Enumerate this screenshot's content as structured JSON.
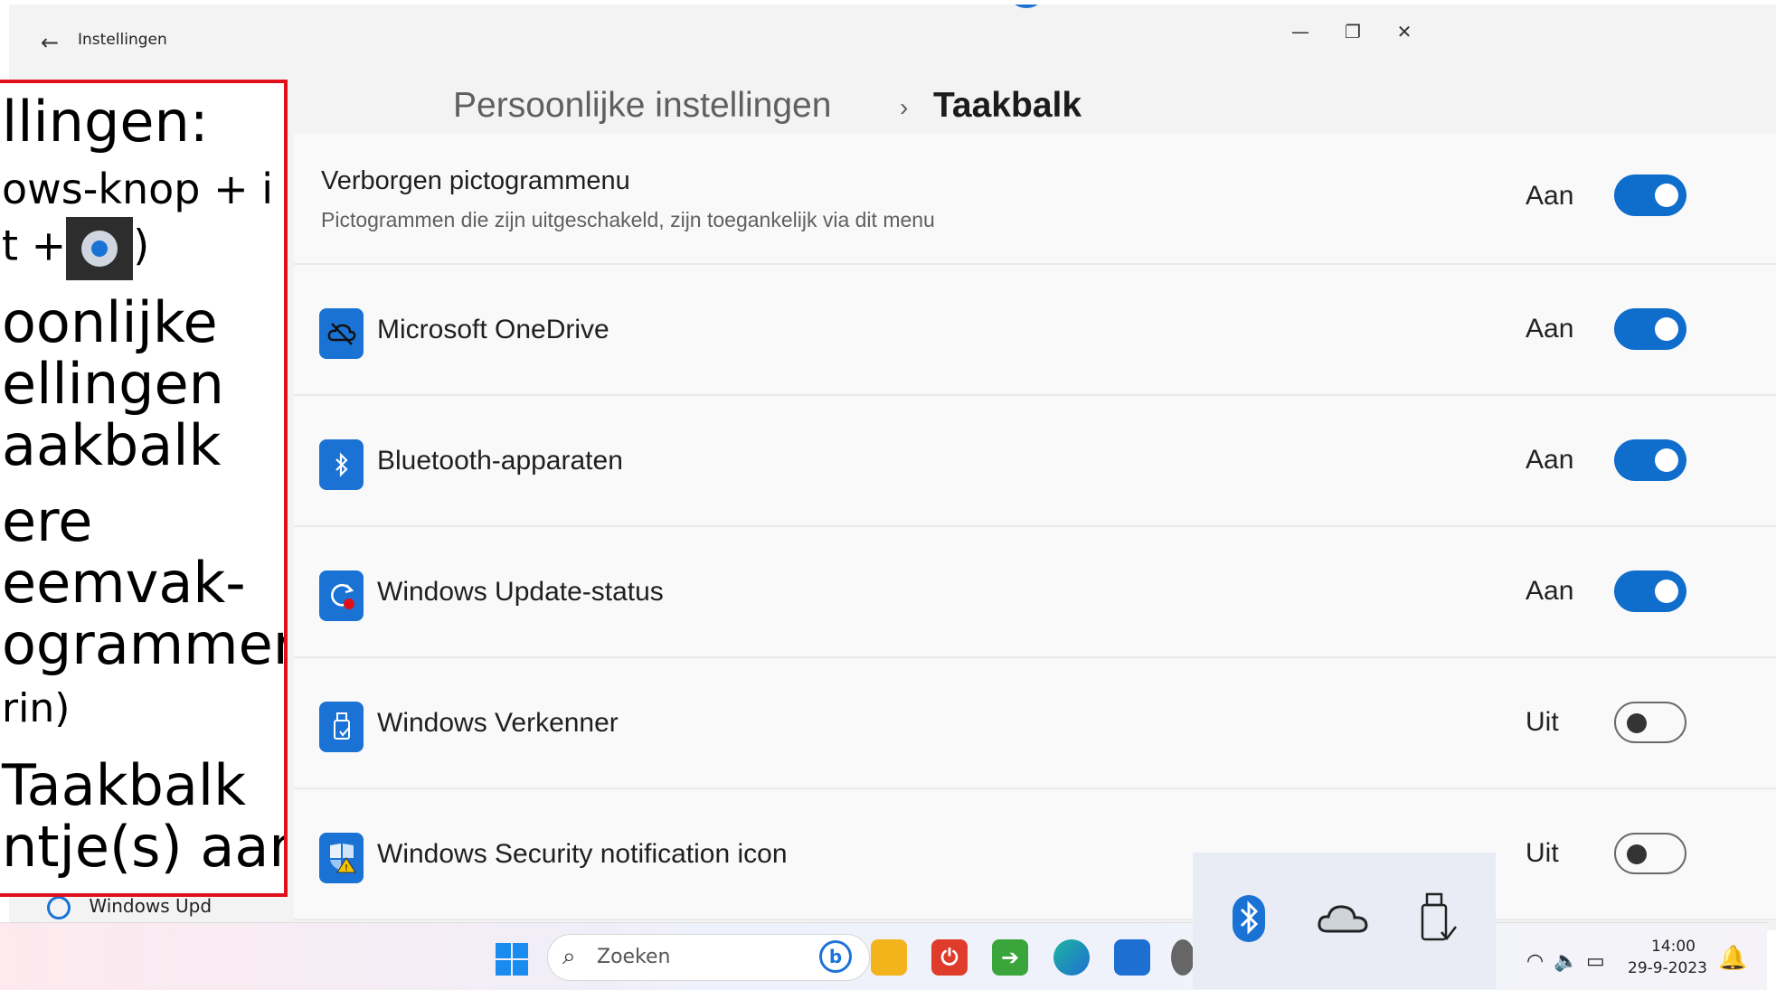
{
  "window": {
    "app_title": "Instellingen",
    "back_label": "←",
    "minimize_label": "—",
    "maximize_label": "❐",
    "close_label": "✕"
  },
  "breadcrumb": {
    "parent": "Persoonlijke instellingen",
    "separator": "›",
    "current": "Taakbalk"
  },
  "hidden_menu": {
    "title": "Verborgen pictogrammenu",
    "description": "Pictogrammen die zijn uitgeschakeld, zijn toegankelijk via dit menu",
    "state": "Aan",
    "on": true
  },
  "items": [
    {
      "label": "Microsoft OneDrive",
      "state": "Aan",
      "on": true,
      "icon": "onedrive-icon"
    },
    {
      "label": "Bluetooth-apparaten",
      "state": "Aan",
      "on": true,
      "icon": "bluetooth-icon"
    },
    {
      "label": "Windows Update-status",
      "state": "Aan",
      "on": true,
      "icon": "windows-update-icon"
    },
    {
      "label": "Windows Verkenner",
      "state": "Uit",
      "on": false,
      "icon": "usb-drive-icon"
    },
    {
      "label": "Windows Security notification icon",
      "state": "Uit",
      "on": false,
      "icon": "windows-security-icon"
    }
  ],
  "instructions": {
    "line1": "llingen:",
    "line2": "ows-knop + i",
    "line3a": "t +",
    "line3b": ")",
    "line4": "oonlijke",
    "line5": "ellingen",
    "line6": "aakbalk",
    "line7": "ere",
    "line8": "eemvak-",
    "line9": "ogrammen",
    "line10": "rin)",
    "line11": "Taakbalk",
    "line12": "ntje(s) aan"
  },
  "behind_text": "Windows Upd",
  "taskbar": {
    "search_placeholder": "Zoeken",
    "time": "14:00",
    "date": "29-9-2023"
  },
  "colors": {
    "accent": "#0f6dcc",
    "highlight_border": "#e0101a"
  }
}
